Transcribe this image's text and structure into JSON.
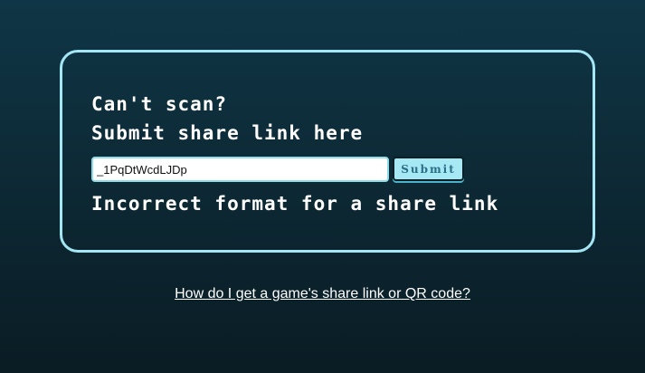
{
  "panel": {
    "heading_line1": "Can't scan?",
    "heading_line2": "Submit share link here",
    "input_value": "_1PqDtWcdLJDp",
    "submit_label": "Submit",
    "error_message": "Incorrect format for a share link"
  },
  "help_link": {
    "text": "How do I get a game's share link or QR code?"
  },
  "colors": {
    "panel_border": "#a5e6f5",
    "button_bg": "#a7e8f5",
    "button_text": "#2a6f86"
  }
}
